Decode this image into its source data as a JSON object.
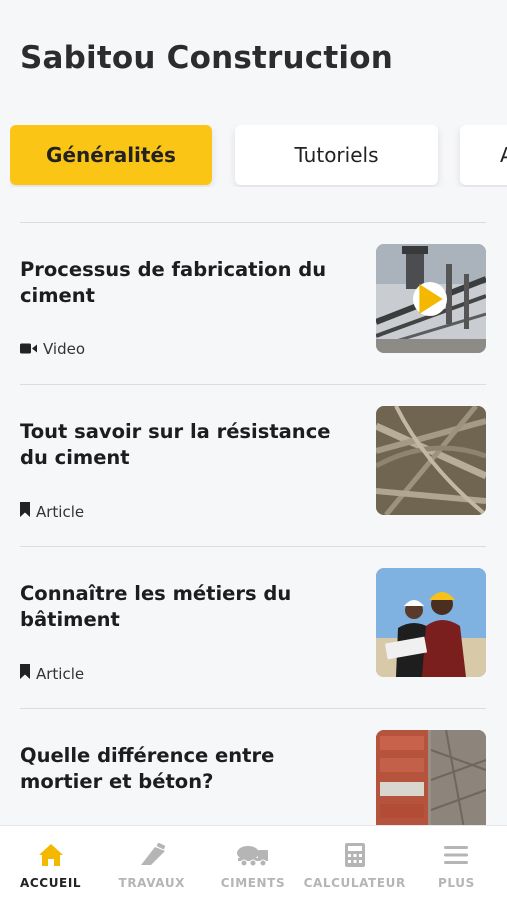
{
  "header": {
    "title": "Sabitou Construction"
  },
  "tabs": [
    {
      "label": "Généralités",
      "active": true
    },
    {
      "label": "Tutoriels",
      "active": false
    },
    {
      "label": "A",
      "active": false
    }
  ],
  "feed": {
    "items": [
      {
        "title": "Processus de fabrication du ciment",
        "type": "Video",
        "type_icon": "video-camera-icon",
        "thumbnail": "cement-plant-conveyors",
        "has_play": true
      },
      {
        "title": "Tout savoir sur la résistance du ciment",
        "type": "Article",
        "type_icon": "bookmark-icon",
        "thumbnail": "highway-interchange-aerial",
        "has_play": false
      },
      {
        "title": "Connaître les métiers du bâtiment",
        "type": "Article",
        "type_icon": "bookmark-icon",
        "thumbnail": "construction-workers-hardhats",
        "has_play": false
      },
      {
        "title": "Quelle différence entre mortier et béton?",
        "type": "",
        "type_icon": "",
        "thumbnail": "bricks-and-concrete",
        "has_play": false
      }
    ]
  },
  "bottom_nav": {
    "items": [
      {
        "label": "ACCUEIL",
        "icon": "home-icon",
        "active": true
      },
      {
        "label": "TRAVAUX",
        "icon": "trowel-icon",
        "active": false
      },
      {
        "label": "CIMENTS",
        "icon": "concrete-truck-icon",
        "active": false
      },
      {
        "label": "CALCULATEUR",
        "icon": "calculator-icon",
        "active": false
      },
      {
        "label": "PLUS",
        "icon": "menu-icon",
        "active": false
      }
    ]
  },
  "colors": {
    "accent": "#fac515",
    "background": "#f6f7f9",
    "inactive_nav": "#b5b5b5"
  }
}
